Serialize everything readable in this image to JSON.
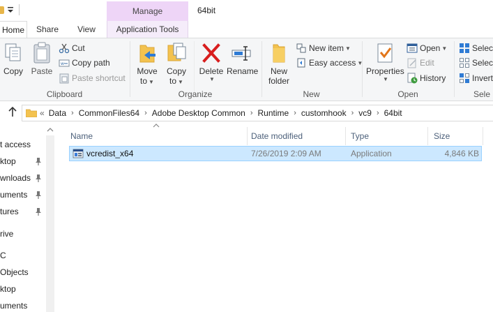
{
  "title_bar": {
    "contextual_tab_group": "Manage",
    "window_title": "64bit"
  },
  "tabs": [
    {
      "label": "Home"
    },
    {
      "label": "Share"
    },
    {
      "label": "View"
    },
    {
      "label": "Application Tools"
    }
  ],
  "ribbon": {
    "clipboard": {
      "group_label": "Clipboard",
      "copy": "Copy",
      "paste": "Paste",
      "cut": "Cut",
      "copy_path": "Copy path",
      "paste_shortcut": "Paste shortcut"
    },
    "organize": {
      "group_label": "Organize",
      "move_to_1": "Move",
      "move_to_2": "to",
      "copy_to_1": "Copy",
      "copy_to_2": "to",
      "delete": "Delete",
      "rename": "Rename"
    },
    "new": {
      "group_label": "New",
      "new_folder_1": "New",
      "new_folder_2": "folder",
      "new_item": "New item",
      "easy_access": "Easy access"
    },
    "open": {
      "group_label": "Open",
      "properties": "Properties",
      "open": "Open",
      "edit": "Edit",
      "history": "History"
    },
    "select": {
      "group_label": "Sele",
      "select_all": "Select",
      "select_none": "Select",
      "invert": "Invert"
    }
  },
  "address": {
    "overflow": "«",
    "crumbs": [
      "Data",
      "CommonFiles64",
      "Adobe Desktop Common",
      "Runtime",
      "customhook",
      "vc9",
      "64bit"
    ]
  },
  "nav_pane": {
    "items": [
      {
        "label": "t access",
        "pinned": false
      },
      {
        "label": "ktop",
        "pinned": true
      },
      {
        "label": "wnloads",
        "pinned": true
      },
      {
        "label": "uments",
        "pinned": true
      },
      {
        "label": "tures",
        "pinned": true
      },
      {
        "label": "rive",
        "pinned": false
      },
      {
        "label": "C",
        "pinned": false
      },
      {
        "label": "Objects",
        "pinned": false
      },
      {
        "label": "ktop",
        "pinned": false
      },
      {
        "label": "uments",
        "pinned": false
      }
    ]
  },
  "file_list": {
    "columns": {
      "name": "Name",
      "date_modified": "Date modified",
      "type": "Type",
      "size": "Size"
    },
    "rows": [
      {
        "name": "vcredist_x64",
        "date_modified": "7/26/2019 2:09 AM",
        "type": "Application",
        "size": "4,846 KB",
        "icon": "installer-app-icon",
        "selected": true
      }
    ]
  },
  "colors": {
    "manage_tab": "#eed5f7",
    "selection_fill": "#cce8ff",
    "selection_border": "#99d1ff",
    "ribbon_bg": "#f5f6f7",
    "column_header_text": "#4c607a"
  }
}
